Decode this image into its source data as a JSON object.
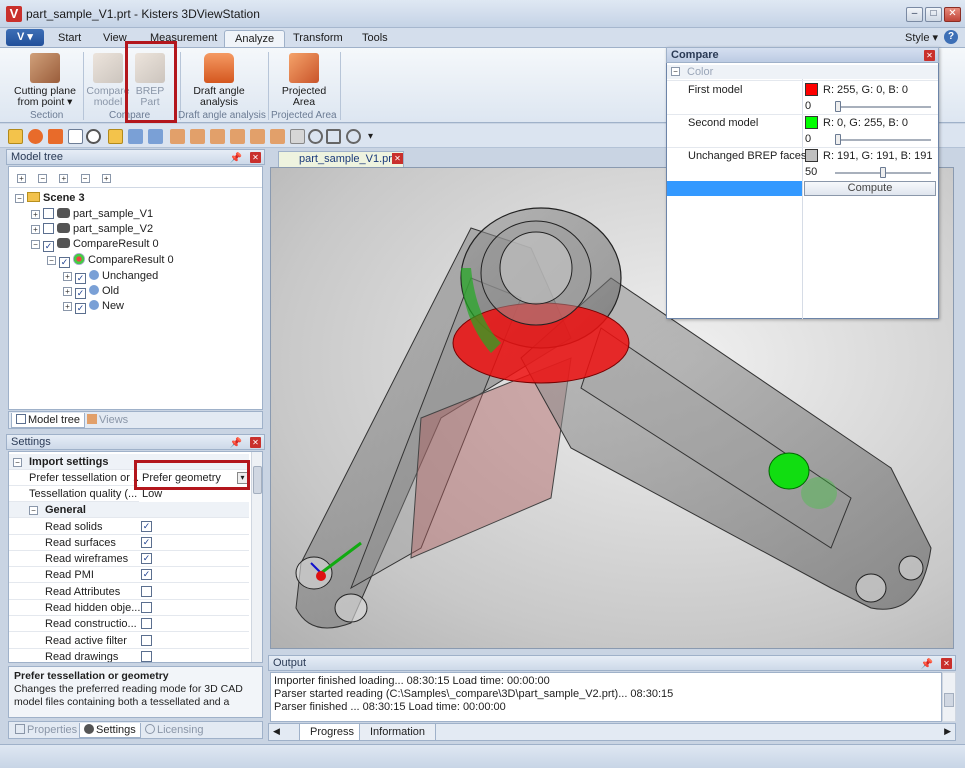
{
  "window": {
    "title": "part_sample_V1.prt - Kisters 3DViewStation",
    "app_letter": "V"
  },
  "ribbon_tabs": [
    "Start",
    "View",
    "Measurement",
    "Analyze",
    "Transform",
    "Tools"
  ],
  "ribbon_active_tab": "Analyze",
  "style_label": "Style",
  "ribbon": {
    "cutting_plane_1": "Cutting plane",
    "cutting_plane_2": "from point",
    "compare_model_1": "Compare",
    "compare_model_2": "model",
    "brep_part_1": "BREP",
    "brep_part_2": "Part",
    "draft_angle_1": "Draft angle",
    "draft_angle_2": "analysis",
    "projected_area_1": "Projected",
    "projected_area_2": "Area",
    "group_section": "Section",
    "group_compare": "Compare",
    "group_draft": "Draft angle analysis",
    "group_projected": "Projected Area"
  },
  "model_tree": {
    "title": "Model tree",
    "scene": "Scene 3",
    "items": [
      "part_sample_V1",
      "part_sample_V2",
      "CompareResult 0",
      "CompareResult 0",
      "Unchanged",
      "Old",
      "New"
    ]
  },
  "left_tabs": {
    "model_tree": "Model tree",
    "views": "Views"
  },
  "settings": {
    "title": "Settings",
    "section_import": "Import settings",
    "prefer_label": "Prefer tessellation or ...",
    "prefer_value": "Prefer geometry",
    "quality_label": "Tessellation quality (...",
    "quality_value": "Low",
    "section_general": "General",
    "rows": [
      "Read solids",
      "Read surfaces",
      "Read wireframes",
      "Read PMI",
      "Read Attributes",
      "Read hidden obje...",
      "Read constructio...",
      "Read active filter",
      "Read drawings"
    ],
    "desc_title": "Prefer tessellation or geometry",
    "desc_text": "Changes the preferred reading mode for 3D CAD model files containing both a tessellated and a"
  },
  "bottom_left_tabs": {
    "properties": "Properties",
    "settings": "Settings",
    "licensing": "Licensing"
  },
  "document_tab": "part_sample_V1.prt",
  "compare": {
    "title": "Compare",
    "section": "Color",
    "first_label": "First model",
    "first_value": "R: 255, G: 0, B: 0",
    "first_num": "0",
    "second_label": "Second model",
    "second_value": "R: 0, G: 255, B: 0",
    "second_num": "0",
    "unchanged_label": "Unchanged BREP faces",
    "unchanged_value": "R: 191, G: 191, B: 191",
    "unchanged_num": "50",
    "compute": "Compute",
    "first_color": "#ff0000",
    "second_color": "#00ff00",
    "unchanged_color": "#bfbfbf"
  },
  "output": {
    "title": "Output",
    "lines": [
      "Importer finished loading... 08:30:15 Load time: 00:00:00",
      "Parser started reading (C:\\Samples\\_compare\\3D\\part_sample_V2.prt)... 08:30:15",
      "Parser finished ... 08:30:15 Load time: 00:00:00"
    ],
    "tab_progress": "Progress",
    "tab_information": "Information"
  }
}
